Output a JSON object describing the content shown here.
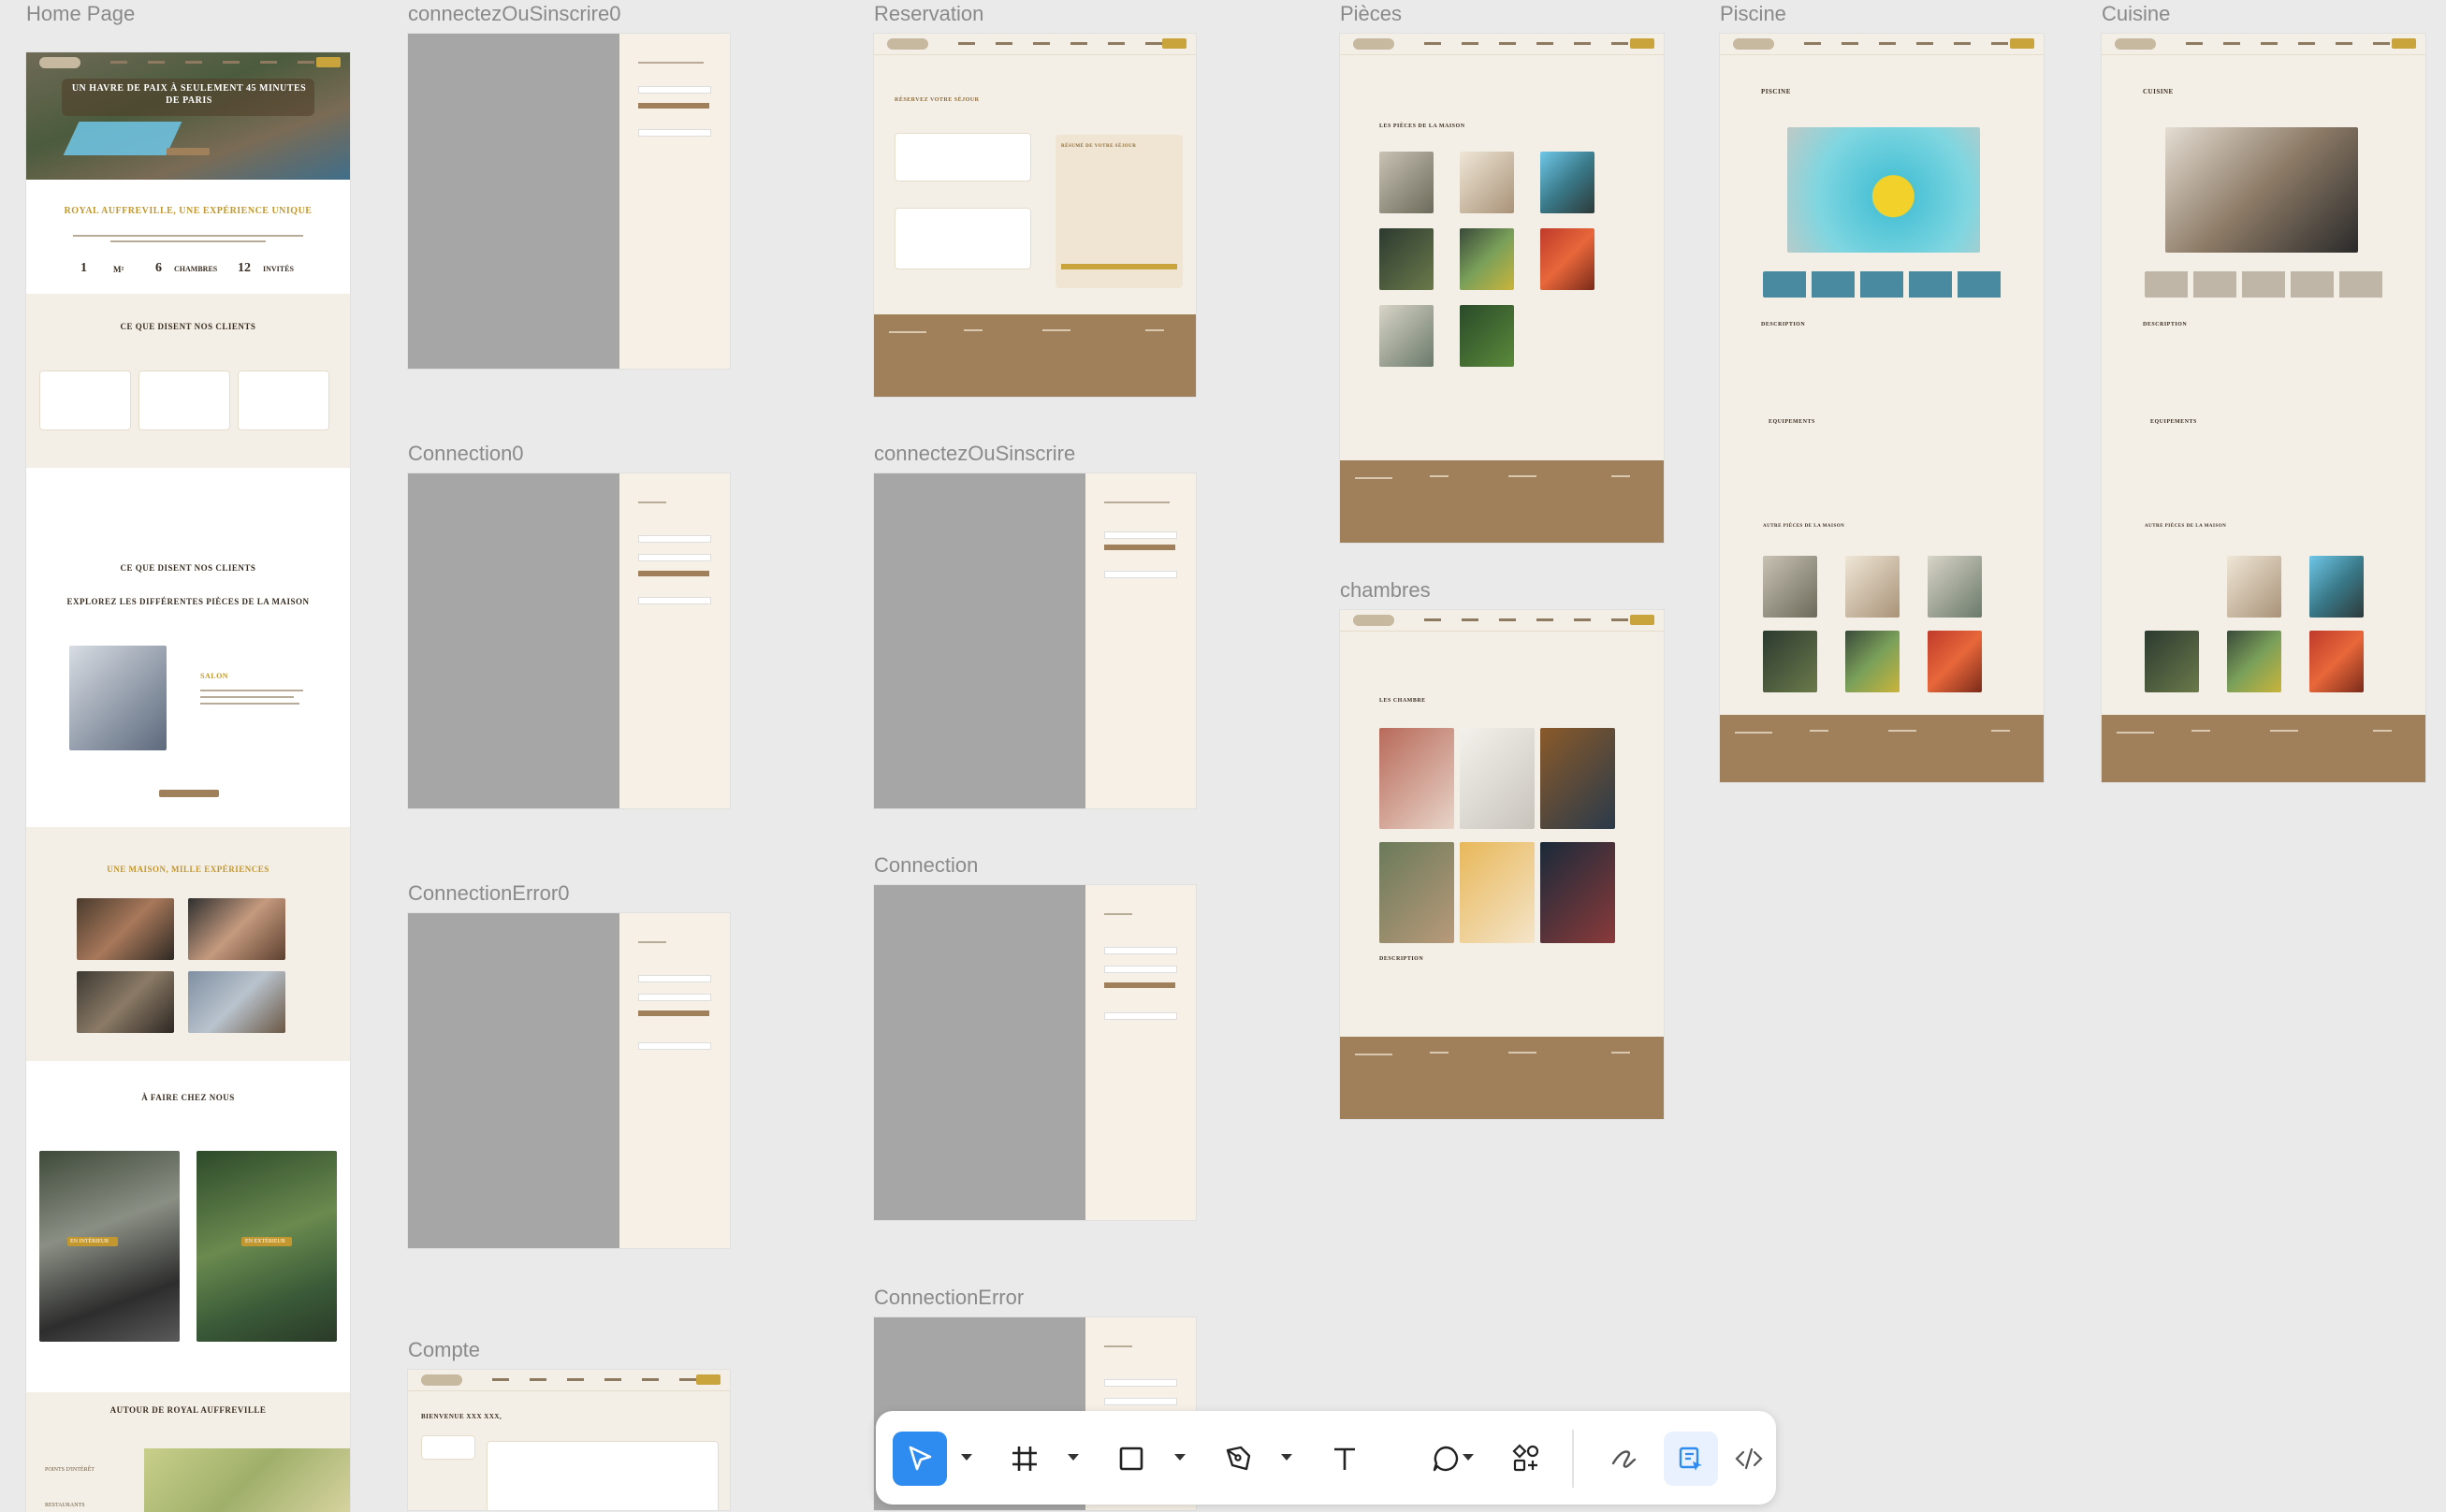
{
  "frames": {
    "home_page": "Home Page",
    "connectez0": "connectezOuSinscrire0",
    "connection0": "Connection0",
    "connection_error0": "ConnectionError0",
    "compte": "Compte",
    "reservation": "Reservation",
    "connectez": "connectezOuSinscrire",
    "connection": "Connection",
    "connection_error": "ConnectionError",
    "pieces": "Pièces",
    "chambres": "chambres",
    "piscine": "Piscine",
    "cuisine": "Cuisine"
  },
  "home": {
    "hero_title": "Un havre de paix à seulement 45 minutes de Paris",
    "about_title": "Royal Auffreville, une expérience unique",
    "stat1_num": "1",
    "stat1_unit": "m²",
    "stat2_num": "6",
    "stat2_unit": "chambres",
    "stat3_num": "12",
    "stat3_unit": "invités",
    "reviews_title": "Ce que disent nos clients",
    "explore_title": "Explorez les différentes pièces de la maison",
    "salon": "Salon",
    "experiences_title": "Une maison, mille expériences",
    "todo_title": "À faire chez nous",
    "tag_left": "En intérieur",
    "tag_right": "En extérieur",
    "around_title": "Autour de Royal Auffreville",
    "around_item1": "Points d'intérêt",
    "around_item2": "Restaurants"
  },
  "reservation": {
    "title": "Réservez votre séjour",
    "summary": "Résumé de votre séjour"
  },
  "pieces": {
    "title": "Les pièces de la maison"
  },
  "chambres": {
    "title": "Les chambre",
    "desc": "Description"
  },
  "piscine": {
    "title": "Piscine",
    "desc": "Description",
    "equip": "Equipements",
    "other": "Autre pièces de la maison"
  },
  "cuisine": {
    "title": "Cuisine",
    "desc": "Description",
    "equip": "Equipements",
    "other": "Autre pièces de la maison"
  },
  "compte": {
    "title": "Bienvenue XXX XXX,"
  },
  "toolbar": {
    "tools": [
      "move-tool",
      "frame-tool",
      "rectangle-tool",
      "pen-tool",
      "text-tool",
      "comment-tool",
      "actions-tool",
      "draw-mode",
      "design-mode",
      "dev-mode"
    ]
  }
}
